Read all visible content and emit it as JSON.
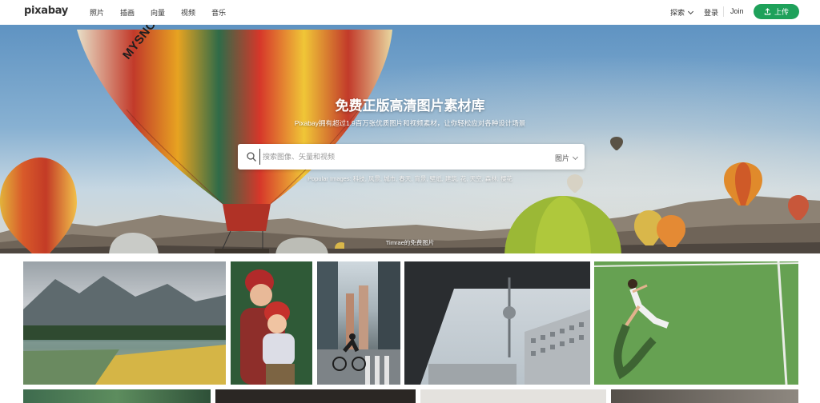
{
  "header": {
    "logo": "pixabay",
    "nav": [
      "照片",
      "插画",
      "向量",
      "视频",
      "音乐"
    ],
    "explore_label": "探索",
    "login_label": "登录",
    "join_label": "Join",
    "upload_label": "上传"
  },
  "hero": {
    "title": "免费正版高清图片素材库",
    "subtitle": "Pixabay拥有超过1.9百万张优质图片和视频素材，让你轻松应对各种设计场景",
    "search_placeholder": "搜索图像、矢量和视频",
    "search_type": "图片",
    "popular": "Popular Images: 科技, 风景, 城市, 春天, 背景, 壁纸, 建筑, 花, 天空, 森林, 樱花",
    "credit": "Timrae的免费图片",
    "balloon_text": "MYSNOWBALLOONS.NET"
  },
  "colors": {
    "accent": "#1ea15a",
    "text": "#333333"
  },
  "gallery": {
    "photos": [
      "mountain-lake-photo",
      "mother-child-photo",
      "city-cyclist-photo",
      "tv-tower-photo",
      "tennis-player-photo"
    ]
  }
}
